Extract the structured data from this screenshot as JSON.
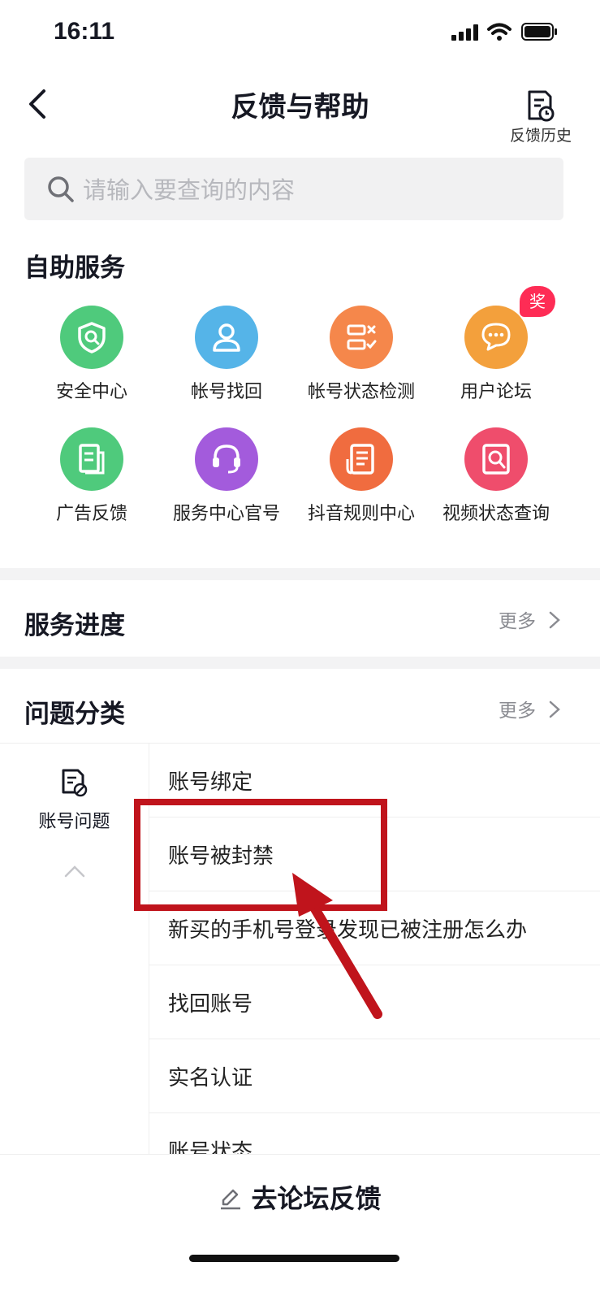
{
  "status_bar": {
    "time": "16:11"
  },
  "header": {
    "title": "反馈与帮助",
    "history_label": "反馈历史"
  },
  "search": {
    "placeholder": "请输入要查询的内容"
  },
  "self_service": {
    "title": "自助服务",
    "badge": "奖",
    "items": [
      {
        "label": "安全中心",
        "icon": "shield-search-icon",
        "color": "#4fca7c"
      },
      {
        "label": "帐号找回",
        "icon": "user-icon",
        "color": "#55b4e8"
      },
      {
        "label": "帐号状态检测",
        "icon": "checklist-icon",
        "color": "#f5874b"
      },
      {
        "label": "用户论坛",
        "icon": "chat-bubbles-icon",
        "color": "#f3a03c"
      },
      {
        "label": "广告反馈",
        "icon": "document-icon",
        "color": "#4fca7c"
      },
      {
        "label": "服务中心官号",
        "icon": "headset-icon",
        "color": "#a35bdc"
      },
      {
        "label": "抖音规则中心",
        "icon": "rules-doc-icon",
        "color": "#f06c3f"
      },
      {
        "label": "视频状态查询",
        "icon": "doc-search-icon",
        "color": "#ef4d6c"
      }
    ]
  },
  "progress": {
    "title": "服务进度",
    "more": "更多"
  },
  "categories": {
    "title": "问题分类",
    "more": "更多",
    "left": {
      "label": "账号问题",
      "icon": "account-issue-icon"
    },
    "items": [
      "账号绑定",
      "账号被封禁",
      "新买的手机号登录发现已被注册怎么办",
      "找回账号",
      "实名认证",
      "账号状态"
    ]
  },
  "bottom": {
    "forum_label": "去论坛反馈"
  },
  "colors": {
    "annotation_red": "#c0141c",
    "badge": "#fe2c55"
  }
}
